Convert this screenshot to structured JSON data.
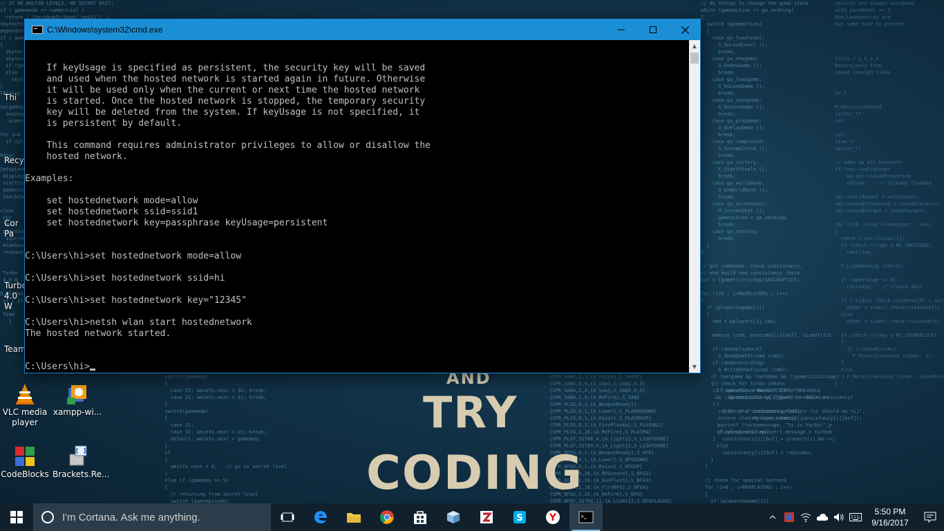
{
  "desktop": {
    "icons": [
      {
        "label": "VLC media player"
      },
      {
        "label": "xampp-wi..."
      },
      {
        "label": "CodeBlocks"
      },
      {
        "label": "Brackets.Re..."
      },
      {
        "label": "Thi"
      },
      {
        "label": "Recyc"
      },
      {
        "label": "Cor Pa"
      },
      {
        "label": "Turbo 4.0 W"
      },
      {
        "label": "Team"
      }
    ],
    "wallpaper_text": {
      "and": "AND",
      "try": "TRY",
      "coding": "CODING"
    }
  },
  "cmd_window": {
    "title": "C:\\Windows\\system32\\cmd.exe",
    "lines": [
      "",
      "",
      "    If keyUsage is specified as persistent, the security key will be saved",
      "    and used when the hosted network is started again in future. Otherwise",
      "    it will be used only when the current or next time the hosted network",
      "    is started. Once the hosted network is stopped, the temporary security",
      "    key will be deleted from the system. If keyUsage is not specified, it",
      "    is persistent by default.",
      "",
      "    This command requires administrator privileges to allow or disallow the",
      "    hosted network.",
      "",
      "Examples:",
      "",
      "    set hostednetwork mode=allow",
      "    set hostednetwork ssid=ssid1",
      "    set hostednetwork key=passphrase keyUsage=persistent",
      "",
      "",
      "C:\\Users\\hi>set hostednetwork mode=allow",
      "",
      "C:\\Users\\hi>set hostednetwork ssid=hi",
      "",
      "C:\\Users\\hi>set hostednetwork key=\"12345\"",
      "",
      "C:\\Users\\hi>netsh wlan start hostednetwork",
      "The hosted network started.",
      "",
      ""
    ],
    "prompt": "C:\\Users\\hi>"
  },
  "taskbar": {
    "cortana_placeholder": "I'm Cortana. Ask me anything.",
    "apps": [
      "task-view",
      "edge",
      "file-explorer",
      "chrome",
      "store",
      "virtualbox",
      "filezilla",
      "skype",
      "yandex",
      "cmd"
    ],
    "clock": {
      "time": "5:50 PM",
      "date": "9/16/2017"
    }
  },
  "colors": {
    "titlebar": "#1b8fd6",
    "console_text": "#c0c0c0",
    "taskbar": "#10202c"
  }
}
